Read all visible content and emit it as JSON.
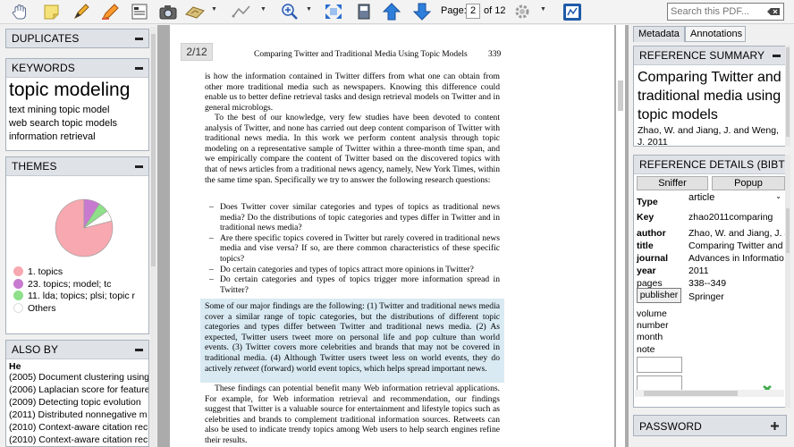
{
  "toolbar": {
    "page_label": "Page:",
    "page_value": "2",
    "page_of": "of 12",
    "search_placeholder": "Search this PDF..."
  },
  "left": {
    "duplicates_title": "DUPLICATES",
    "keywords_title": "KEYWORDS",
    "keywords": {
      "big": "topic modeling",
      "line1": "text mining  topic model",
      "line2": "web search  topic models",
      "line3": "information retrieval"
    },
    "themes_title": "THEMES",
    "themes_legend": [
      {
        "label": "1. topics",
        "color": "#f7a8b0"
      },
      {
        "label": "23. topics; model; tc",
        "color": "#c87ad0"
      },
      {
        "label": "11. lda; topics; plsi; topic r",
        "color": "#8ee08a"
      },
      {
        "label": "Others",
        "color": "#ffffff"
      }
    ],
    "themes_chart": {
      "values": [
        79,
        9,
        6,
        6
      ]
    },
    "also_by_title": "ALSO BY",
    "also_by_author": "He",
    "also_by_items": [
      "(2005) Document clustering using",
      "(2006) Laplacian score for feature",
      "(2009) Detecting topic evolution",
      "(2011) Distributed nonnegative m",
      "(2010) Context-aware citation rec",
      "(2010) Context-aware citation rec"
    ]
  },
  "doc": {
    "page_badge": "2/12",
    "running_head": "Comparing Twitter and Traditional Media Using Topic Models",
    "page_number": "339",
    "para1": "is how the information contained in Twitter differs from what one can obtain from other more traditional media such as newspapers. Knowing this difference could enable us to better define retrieval tasks and design retrieval models on Twitter and in general microblogs.",
    "para2": "To the best of our knowledge, very few studies have been devoted to content analysis of Twitter, and none has carried out deep content comparison of Twitter with traditional news media. In this work we perform content analysis through topic modeling on a representative sample of Twitter within a three-month time span, and we empirically compare the content of Twitter based on the discovered topics with that of news articles from a traditional news agency, namely, New York Times, within the same time span. Specifically we try to answer the following research questions:",
    "bullets": [
      "Does Twitter cover similar categories and types of topics as traditional news media? Do the distributions of topic categories and types differ in Twitter and in traditional news media?",
      "Are there specific topics covered in Twitter but rarely covered in traditional news media and vise versa? If so, are there common characteristics of these specific topics?",
      "Do certain categories and types of topics attract more opinions in Twitter?",
      "Do certain categories and types of topics trigger more information spread in Twitter?"
    ],
    "para3_pre": "Some of our major findings are the following: (1) Twitter and traditional news media cover a similar range of topic categories, but the distributions of different topic categories and types differ between Twitter and traditional news media. (2) As expected, Twitter users tweet more on personal life and pop culture than world events. (3) Twitter covers more celebrities and brands that may not be covered in traditional media. (4) Although Twitter users tweet less on world events, they do actively ",
    "para3_em": "retweet",
    "para3_post": " (forward) world event topics, which helps spread important news.",
    "para4": "These findings can potential benefit many Web information retrieval applications. For example, for Web information retrieval and recommendation, our findings suggest that Twitter is a valuable source for entertainment and lifestyle topics such as celebrities and brands to complement traditional information sources. Retweets can also be used to indicate trendy topics among Web users to help search engines refine their results."
  },
  "right": {
    "tab_metadata": "Metadata",
    "tab_annotations": "Annotations",
    "summary_title": "REFERENCE SUMMARY",
    "ref_title": "Comparing Twitter and traditional media using topic models",
    "ref_authors": "Zhao, W. and Jiang, J. and Weng, J. 2011",
    "details_title": "REFERENCE DETAILS (BIBTE",
    "sniffer": "Sniffer",
    "popup": "Popup",
    "type_key": "Type",
    "type_value": "article",
    "key_key": "Key",
    "key_value": "zhao2011comparing",
    "author_key": "author",
    "author_value": "Zhao, W. and Jiang, J. a",
    "title_key": "title",
    "title_value1": "Comparing Twitter and",
    "title_value2": "Advances in Informatio",
    "journal_key": "journal",
    "year_key": "year",
    "year_value": "2011",
    "pages_key": "pages",
    "pages_value": "338--349",
    "publisher_key": "publisher",
    "publisher_value": "Springer",
    "volume_key": "volume",
    "number_key": "number",
    "month_key": "month",
    "note_key": "note",
    "password_title": "PASSWORD"
  }
}
